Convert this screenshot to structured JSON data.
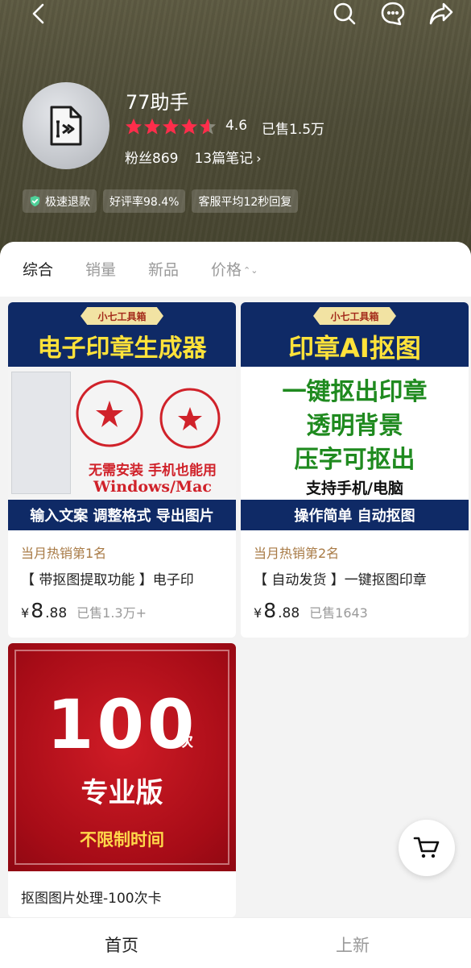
{
  "header": {
    "shop_name": "77助手",
    "rating": "4.6",
    "rating_value": 4.6,
    "sold": "已售1.5万",
    "fans": "粉丝869",
    "notes": "13篇笔记",
    "notes_chevron": "›",
    "badges": [
      "极速退款",
      "好评率98.4%",
      "客服平均12秒回复"
    ],
    "icons": [
      "back-icon",
      "search-icon",
      "chat-icon",
      "share-icon"
    ]
  },
  "sort_tabs": {
    "overall": "综合",
    "sales": "销量",
    "new": "新品",
    "price": "价格",
    "price_sort_icon": "⌃⌄"
  },
  "products": [
    {
      "thumb": {
        "ribbon": "小七工具箱",
        "headline": "电子印章生成器",
        "mid_line1": "无需安装  手机也能用",
        "mid_line2": "Windows/Mac",
        "footer": "输入文案 调整格式 导出图片"
      },
      "tag": "当月热销第1名",
      "title": "【 带抠图提取功能 】电子印",
      "currency": "¥",
      "price_int": "8",
      "price_dec": ".88",
      "sold": "已售1.3万+"
    },
    {
      "thumb": {
        "ribbon": "小七工具箱",
        "headline": "印章AI抠图",
        "lines": [
          "一键抠出印章",
          "透明背景",
          "压字可抠出"
        ],
        "subline": "支持手机/电脑",
        "footer": "操作简单  自动抠图"
      },
      "tag": "当月热销第2名",
      "title": "【 自动发货 】一键抠图印章",
      "currency": "¥",
      "price_int": "8",
      "price_dec": ".88",
      "sold": "已售1643"
    },
    {
      "thumb": {
        "big_number": "100",
        "unit": "次",
        "edition": "专业版",
        "note": "不限制时间"
      },
      "title": "抠图图片处理-100次卡"
    }
  ],
  "bottom_nav": {
    "home": "首页",
    "new": "上新"
  },
  "colors": {
    "star": "#ff2d4b",
    "tag": "#a87a45",
    "navy": "#0f2a66",
    "headline_yellow": "#ffe23a",
    "red_card": "#b00f1a"
  }
}
